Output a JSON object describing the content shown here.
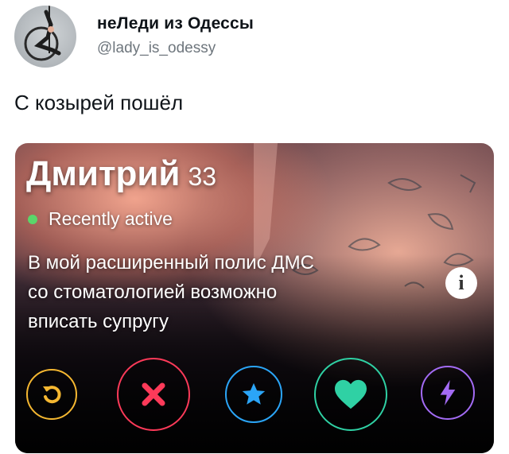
{
  "tweet": {
    "display_name": "неЛеди из Одессы",
    "handle": "@lady_is_odessy",
    "text": "С козырей пошёл"
  },
  "profile_card": {
    "name": "Дмитрий",
    "age": "33",
    "status": "Recently active",
    "bio": "В мой расширенный полис ДМС\nсо стоматологией возможно\nвписать супругу",
    "info_label": "i"
  },
  "actions": [
    {
      "name": "rewind-button",
      "icon": "rewind-icon",
      "color": "#f5b731"
    },
    {
      "name": "nope-button",
      "icon": "close-icon",
      "color": "#fd3a59"
    },
    {
      "name": "super-like-button",
      "icon": "star-icon",
      "color": "#2ba5f7"
    },
    {
      "name": "like-button",
      "icon": "heart-icon",
      "color": "#2fd1a4"
    },
    {
      "name": "boost-button",
      "icon": "lightning-icon",
      "color": "#a36bf4"
    }
  ],
  "colors": {
    "active_dot": "#5ad56a",
    "handle_text": "#6e767d"
  }
}
